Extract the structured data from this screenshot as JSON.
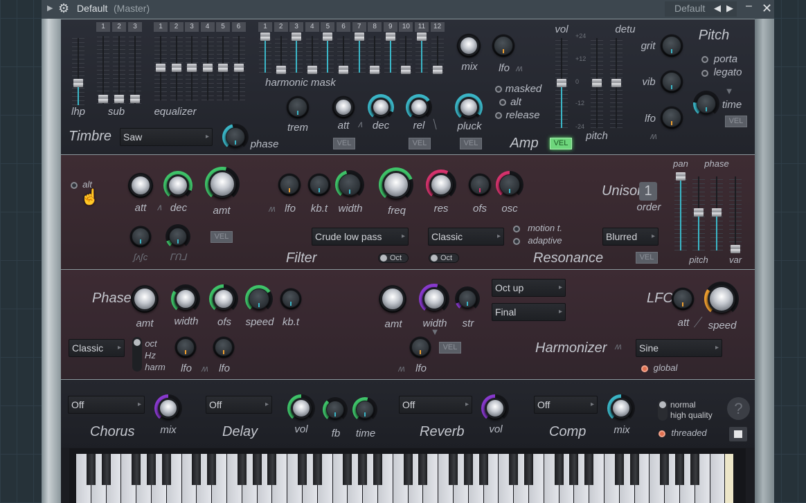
{
  "titlebar": {
    "title": "Default",
    "subtitle": "(Master)",
    "preset": "Default",
    "icons": [
      "expand-arrow-icon",
      "gear-icon",
      "prev-preset-icon",
      "next-preset-icon",
      "minimize-icon",
      "close-icon"
    ]
  },
  "timbre": {
    "sub_nums": [
      "1",
      "2",
      "3"
    ],
    "eq_nums": [
      "1",
      "2",
      "3",
      "4",
      "5",
      "6"
    ],
    "harm_nums": [
      "1",
      "2",
      "3",
      "4",
      "5",
      "6",
      "7",
      "8",
      "9",
      "10",
      "11",
      "12"
    ],
    "lhp": "lhp",
    "sub": "sub",
    "equalizer": "equalizer",
    "harmonic_mask": "harmonic mask",
    "title": "Timbre",
    "waveform": "Saw",
    "phase": "phase"
  },
  "amp": {
    "mix": "mix",
    "lfo": "lfo",
    "masked": "masked",
    "alt": "alt",
    "release": "release",
    "trem": "trem",
    "att": "att",
    "dec": "dec",
    "rel": "rel",
    "pluck": "pluck",
    "vel": "VEL",
    "title": "Amp",
    "vol": "vol",
    "detu": "detu",
    "scale": [
      "+24",
      "+12",
      "0",
      "-12",
      "-24"
    ],
    "pitch": "pitch"
  },
  "pitch": {
    "grit": "grit",
    "vib": "vib",
    "lfo": "lfo",
    "title": "Pitch",
    "porta": "porta",
    "legato": "legato",
    "time": "time",
    "vel": "VEL"
  },
  "filter": {
    "alt": "alt",
    "att": "att",
    "dec": "dec",
    "amt": "amt",
    "vel": "VEL",
    "lfo": "lfo",
    "kbt": "kb.t",
    "width": "width",
    "freq": "freq",
    "res": "res",
    "ofs": "ofs",
    "osc": "osc",
    "type": "Crude low pass",
    "oct": "Oct",
    "title": "Filter",
    "res_type": "Classic",
    "oct2": "Oct",
    "motion": "motion t.",
    "adaptive": "adaptive",
    "resonance": "Resonance"
  },
  "unison": {
    "title": "Unison",
    "order_value": "1",
    "order": "order",
    "mode": "Blurred",
    "vel": "VEL",
    "pan": "pan",
    "phase": "phase",
    "pitch": "pitch",
    "var": "var"
  },
  "phaser": {
    "title": "Phaser",
    "amt": "amt",
    "width": "width",
    "ofs": "ofs",
    "speed": "speed",
    "kbt": "kb.t",
    "mode": "Classic",
    "oct": "oct",
    "hz": "Hz",
    "harm": "harm",
    "lfo1": "lfo",
    "lfo2": "lfo"
  },
  "harmonizer": {
    "amt": "amt",
    "width": "width",
    "str": "str",
    "lfo": "lfo",
    "vel": "VEL",
    "mode1": "Oct up",
    "mode2": "Final",
    "title": "Harmonizer"
  },
  "lfo": {
    "title": "LFO",
    "att": "att",
    "speed": "speed",
    "shape": "Sine",
    "global": "global"
  },
  "fx": {
    "chorus": {
      "value": "Off",
      "title": "Chorus",
      "mix": "mix"
    },
    "delay": {
      "value": "Off",
      "title": "Delay",
      "vol": "vol",
      "fb": "fb",
      "time": "time"
    },
    "reverb": {
      "value": "Off",
      "title": "Reverb",
      "vol": "vol"
    },
    "comp": {
      "value": "Off",
      "title": "Comp",
      "mix": "mix"
    },
    "normal": "normal",
    "high_quality": "high quality",
    "threaded": "threaded",
    "help": "?"
  },
  "colors": {
    "cyan": "#3bb7c8",
    "green": "#3fc56a",
    "pink": "#d8336e",
    "purple": "#8a3ad0",
    "orange": "#f0a030",
    "vel_active": "#6ed67c"
  }
}
